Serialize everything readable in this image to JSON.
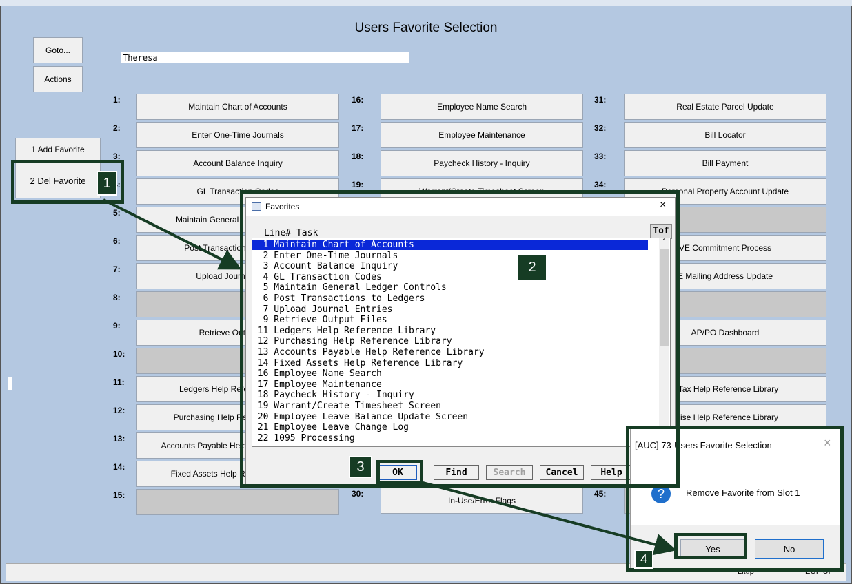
{
  "form": {
    "title": "Users Favorite Selection",
    "user_name": "Theresa",
    "side_buttons": {
      "goto": "Goto...",
      "actions": "Actions",
      "add_favorite": "1 Add Favorite",
      "del_favorite": "2 Del Favorite"
    },
    "slots_col1": [
      {
        "num": "1:",
        "label": "Maintain Chart of Accounts"
      },
      {
        "num": "2:",
        "label": "Enter One-Time Journals"
      },
      {
        "num": "3:",
        "label": "Account Balance Inquiry"
      },
      {
        "num": "4:",
        "label": "GL Transaction Codes"
      },
      {
        "num": "5:",
        "label": "Maintain General Ledger Controls"
      },
      {
        "num": "6:",
        "label": "Post Transactions to Ledgers"
      },
      {
        "num": "7:",
        "label": "Upload Journal Entries"
      },
      {
        "num": "8:",
        "label": ""
      },
      {
        "num": "9:",
        "label": "Retrieve Output Files"
      },
      {
        "num": "10:",
        "label": ""
      },
      {
        "num": "11:",
        "label": "Ledgers Help Reference Library"
      },
      {
        "num": "12:",
        "label": "Purchasing Help Reference Library"
      },
      {
        "num": "13:",
        "label": "Accounts Payable Help Reference Library"
      },
      {
        "num": "14:",
        "label": "Fixed Assets Help Reference Library"
      },
      {
        "num": "15:",
        "label": ""
      }
    ],
    "slots_col2": [
      {
        "num": "16:",
        "label": "Employee Name Search"
      },
      {
        "num": "17:",
        "label": "Employee Maintenance"
      },
      {
        "num": "18:",
        "label": "Paycheck History - Inquiry"
      },
      {
        "num": "19:",
        "label": "Warrant/Create Timesheet Screen"
      },
      {
        "num": "30:",
        "label": "In-Use/Error Flags"
      }
    ],
    "slots_col3": [
      {
        "num": "31:",
        "label": "Real Estate Parcel Update"
      },
      {
        "num": "32:",
        "label": "Bill Locator"
      },
      {
        "num": "33:",
        "label": "Bill Payment"
      },
      {
        "num": "34:",
        "label": "Personal Property Account Update"
      },
      {
        "num": "",
        "label": ""
      },
      {
        "num": "",
        "label": "VE Commitment Process"
      },
      {
        "num": "",
        "label": "E Mailing Address Update"
      },
      {
        "num": "",
        "label": ""
      },
      {
        "num": "",
        "label": "AP/PO Dashboard"
      },
      {
        "num": "",
        "label": ""
      },
      {
        "num": "",
        "label": "y Tax Help Reference Library"
      },
      {
        "num": "",
        "label": "xcise Help Reference Library"
      },
      {
        "num": "45:",
        "label": ""
      }
    ],
    "status_right": [
      "Lkup",
      "EOF UP"
    ]
  },
  "favorites_dialog": {
    "title": "Favorites",
    "close": "×",
    "header": "Line# Task",
    "tof": "Tof",
    "items": [
      "  1 Maintain Chart of Accounts",
      "  2 Enter One-Time Journals",
      "  3 Account Balance Inquiry",
      "  4 GL Transaction Codes",
      "  5 Maintain General Ledger Controls",
      "  6 Post Transactions to Ledgers",
      "  7 Upload Journal Entries",
      "  9 Retrieve Output Files",
      " 11 Ledgers Help Reference Library",
      " 12 Purchasing Help Reference Library",
      " 13 Accounts Payable Help Reference Library",
      " 14 Fixed Assets Help Reference Library",
      " 16 Employee Name Search",
      " 17 Employee Maintenance",
      " 18 Paycheck History - Inquiry",
      " 19 Warrant/Create Timesheet Screen",
      " 20 Employee Leave Balance Update Screen",
      " 21 Employee Leave Change Log",
      " 22 1095 Processing"
    ],
    "buttons": {
      "ok": "OK",
      "find": "Find",
      "search": "Search",
      "cancel": "Cancel",
      "help": "Help"
    }
  },
  "confirm_dialog": {
    "title": "[AUC] 73-Users Favorite Selection",
    "close": "×",
    "message": "Remove Favorite from Slot 1",
    "icon": "?",
    "yes": "Yes",
    "no": "No"
  },
  "annotations": {
    "step1": "1",
    "step2": "2",
    "step3": "3",
    "step4": "4"
  },
  "colors": {
    "annotation": "#163c24",
    "background": "#b4c8e1",
    "selection": "#0a28d8"
  }
}
